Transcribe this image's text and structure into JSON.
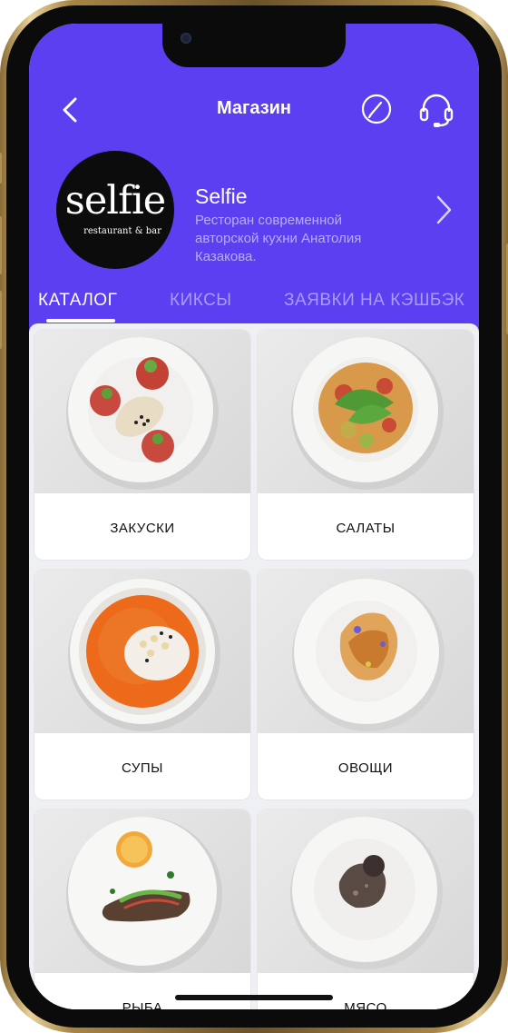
{
  "header": {
    "title": "Магазин",
    "accent_color": "#5b3ff0",
    "back_icon": "chevron-left-icon",
    "edit_icon": "pencil-circle-icon",
    "support_icon": "headset-icon"
  },
  "shop": {
    "logo_word": "selfie",
    "logo_sub": "restaurant & bar",
    "name": "Selfie",
    "description": "Ресторан современной авторской кухни Анатолия Казакова."
  },
  "tabs": [
    {
      "label": "КАТАЛОГ",
      "active": true
    },
    {
      "label": "КИКСЫ",
      "active": false
    },
    {
      "label": "ЗАЯВКИ НА КЭШБЭК",
      "active": false
    }
  ],
  "categories": [
    {
      "label": "ЗАКУСКИ"
    },
    {
      "label": "САЛАТЫ"
    },
    {
      "label": "СУПЫ"
    },
    {
      "label": "ОВОЩИ"
    },
    {
      "label": "РЫБА"
    },
    {
      "label": "МЯСО"
    }
  ]
}
